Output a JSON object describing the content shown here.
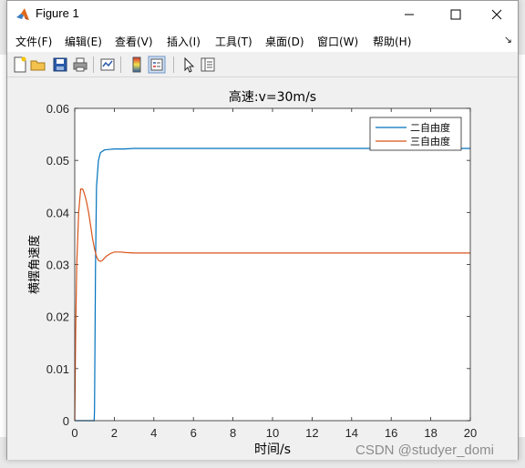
{
  "window": {
    "title": "Figure 1"
  },
  "menu": {
    "items": [
      "文件(F)",
      "编辑(E)",
      "查看(V)",
      "插入(I)",
      "工具(T)",
      "桌面(D)",
      "窗口(W)",
      "帮助(H)"
    ]
  },
  "toolbar": {
    "buttons": [
      "new-figure-icon",
      "open-file-icon",
      "save-icon",
      "print-icon",
      "link-plot-icon",
      "colorbar-icon",
      "legend-icon",
      "edit-plot-pointer-icon",
      "property-inspector-icon"
    ]
  },
  "chart_data": {
    "type": "line",
    "title": "高速:v=30m/s",
    "xlabel": "时间/s",
    "ylabel": "横摆角速度",
    "xlim": [
      0,
      20
    ],
    "ylim": [
      0,
      0.06
    ],
    "xticks": [
      0,
      2,
      4,
      6,
      8,
      10,
      12,
      14,
      16,
      18,
      20
    ],
    "yticks": [
      0,
      0.01,
      0.02,
      0.03,
      0.04,
      0.05,
      0.06
    ],
    "xtick_labels": [
      "0",
      "2",
      "4",
      "6",
      "8",
      "10",
      "12",
      "14",
      "16",
      "18",
      "20"
    ],
    "ytick_labels": [
      "0",
      "0.01",
      "0.02",
      "0.03",
      "0.04",
      "0.05",
      "0.06"
    ],
    "grid": false,
    "legend_position": "top-right",
    "series": [
      {
        "name": "二自由度",
        "color": "#0072bd",
        "x": [
          0,
          0.98,
          1.0,
          1.05,
          1.1,
          1.2,
          1.3,
          1.5,
          1.7,
          2.0,
          2.5,
          3,
          5,
          10,
          15,
          20
        ],
        "y": [
          0,
          0,
          0.002,
          0.03,
          0.045,
          0.05,
          0.0515,
          0.052,
          0.0521,
          0.0522,
          0.0522,
          0.0523,
          0.0523,
          0.0523,
          0.0523,
          0.0523
        ]
      },
      {
        "name": "三自由度",
        "color": "#d95319",
        "x": [
          0,
          0.05,
          0.1,
          0.2,
          0.3,
          0.4,
          0.5,
          0.6,
          0.7,
          0.8,
          0.9,
          1.0,
          1.1,
          1.2,
          1.3,
          1.4,
          1.5,
          1.6,
          1.8,
          2.0,
          2.3,
          2.6,
          3,
          4,
          6,
          10,
          15,
          20
        ],
        "y": [
          0,
          0.018,
          0.03,
          0.04,
          0.0445,
          0.0445,
          0.0435,
          0.042,
          0.04,
          0.0375,
          0.035,
          0.033,
          0.0315,
          0.0308,
          0.0306,
          0.0308,
          0.0312,
          0.0316,
          0.0321,
          0.0324,
          0.0324,
          0.0323,
          0.0322,
          0.0322,
          0.0322,
          0.0322,
          0.0322,
          0.0322
        ]
      }
    ]
  },
  "watermark": "CSDN @studyer_domi"
}
